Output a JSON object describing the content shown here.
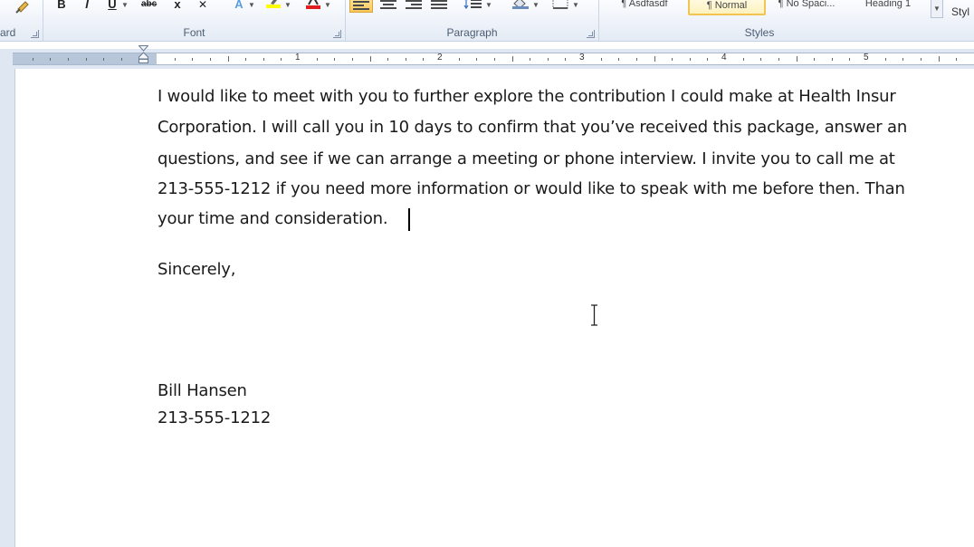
{
  "ribbon": {
    "clipboard": {
      "label": "ard"
    },
    "font": {
      "label": "Font",
      "buttons": {
        "bold": "B",
        "italic": "I",
        "underline": "U",
        "strike": "abc",
        "subscript": "x",
        "clear": "A"
      }
    },
    "paragraph": {
      "label": "Paragraph"
    },
    "styles": {
      "label": "Styles",
      "gallery": [
        "¶ Asdfasdf",
        "¶ Normal",
        "¶ No Spaci...",
        "Heading 1"
      ],
      "change_styles": "Styl"
    }
  },
  "ruler": {
    "numbers": [
      "1",
      "2",
      "3",
      "4",
      "5"
    ]
  },
  "document": {
    "lines": [
      "I would like to meet with you to further explore the contribution I could make at Health Insur",
      "Corporation. I will call you in 10 days to confirm that you’ve received this package, answer an",
      "questions, and see if we can arrange a meeting or phone interview. I invite you to call me at",
      "213-555-1212 if you need more information or would like to speak with me before then. Than",
      "your time and consideration."
    ],
    "closing": "Sincerely,",
    "signature_name": "Bill Hansen",
    "signature_phone": "213-555-1212"
  },
  "colors": {
    "ribbon_bg": "#e4ebf5",
    "highlight_yellow": "#ffff00",
    "font_color_red": "#e02020",
    "active_button": "#f9c85a"
  }
}
